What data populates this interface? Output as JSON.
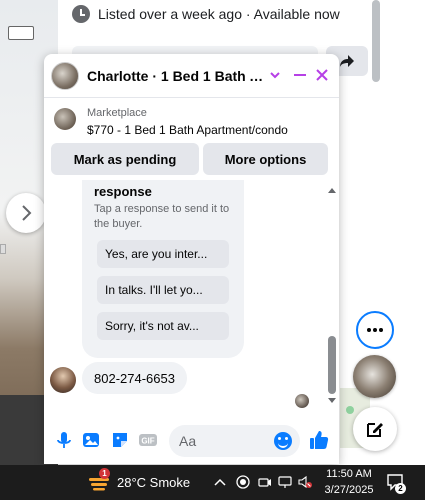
{
  "listing_page": {
    "status_text": "Listed over a week ago · Available now"
  },
  "chat": {
    "title": "Charlotte · 1 Bed 1 Bath Ap...",
    "listing_source": "Marketplace",
    "listing_title": "$770 - 1 Bed 1 Bath Apartment/condo",
    "actions": {
      "mark_pending": "Mark as pending",
      "more_options": "More options"
    },
    "response_card": {
      "title": "response",
      "description": "Tap a response to send it to the buyer.",
      "quick_replies": [
        "Yes, are you inter...",
        "In talks. I'll let yo...",
        "Sorry, it's not av..."
      ]
    },
    "messages": [
      {
        "text": "802-274-6653"
      }
    ],
    "composer": {
      "placeholder": "Aa"
    },
    "colors": {
      "accent": "#0a7cff",
      "header_controls": "#b640e6"
    }
  },
  "taskbar": {
    "weather": "28°C  Smoke",
    "weather_badge": "1",
    "time": "11:50 AM",
    "date": "3/27/2025",
    "notification_count": "2"
  }
}
